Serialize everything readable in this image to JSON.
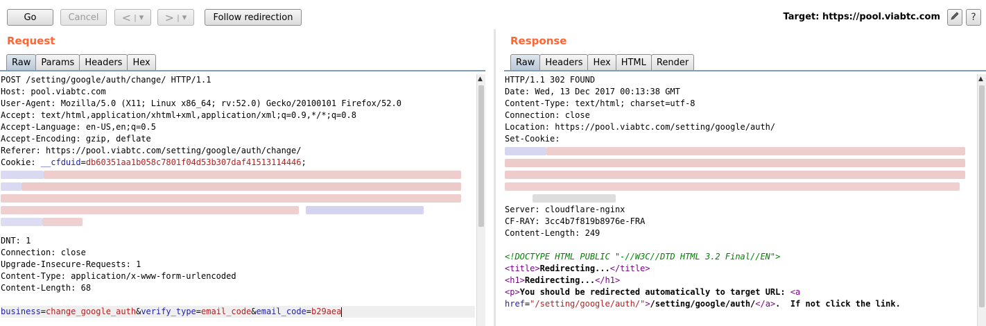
{
  "toolbar": {
    "go": "Go",
    "cancel": "Cancel",
    "back": "<",
    "back_menu": "▾",
    "forward": ">",
    "forward_menu": "▾",
    "follow": "Follow redirection",
    "target_label": "Target: https://pool.viabtc.com",
    "edit_icon": "pencil-icon",
    "help": "?"
  },
  "request": {
    "title": "Request",
    "tabs": [
      "Raw",
      "Params",
      "Headers",
      "Hex"
    ],
    "lines": [
      "POST /setting/google/auth/change/ HTTP/1.1",
      "Host: pool.viabtc.com",
      "User-Agent: Mozilla/5.0 (X11; Linux x86_64; rv:52.0) Gecko/20100101 Firefox/52.0",
      "Accept: text/html,application/xhtml+xml,application/xml;q=0.9,*/*;q=0.8",
      "Accept-Language: en-US,en;q=0.5",
      "Accept-Encoding: gzip, deflate",
      "Referer: https://pool.viabtc.com/setting/google/auth/change/"
    ],
    "cookie": {
      "label": "Cookie: ",
      "name": "__cfduid",
      "eq": "=",
      "value": "db60351aa1b058c7801f04d53b307daf41513114446",
      "end": ";"
    },
    "lines_after": [
      "DNT: 1",
      "Connection: close",
      "Upgrade-Insecure-Requests: 1",
      "Content-Type: application/x-www-form-urlencoded",
      "Content-Length: 68"
    ],
    "body": {
      "k1": "business",
      "v1": "change_google_auth",
      "k2": "verify_type",
      "v2": "email_code",
      "k3": "email_code",
      "v3": "b29aea",
      "eq": "=",
      "amp": "&"
    }
  },
  "response": {
    "title": "Response",
    "tabs": [
      "Raw",
      "Headers",
      "Hex",
      "HTML",
      "Render"
    ],
    "lines": [
      "HTTP/1.1 302 FOUND",
      "Date: Wed, 13 Dec 2017 00:13:38 GMT",
      "Content-Type: text/html; charset=utf-8",
      "Connection: close",
      "Location: https://pool.viabtc.com/setting/google/auth/",
      "Set-Cookie:"
    ],
    "lines_after": [
      "Server: cloudflare-nginx",
      "CF-RAY: 3cc4b7f819b8976e-FRA",
      "Content-Length: 249"
    ],
    "html": {
      "doctype": "<!DOCTYPE HTML PUBLIC \"-//W3C//DTD HTML 3.2 Final//EN\">",
      "title_open": "<title>",
      "title_text": "Redirecting...",
      "title_close": "</title>",
      "h1_open": "<h1>",
      "h1_text": "Redirecting...",
      "h1_close": "</h1>",
      "p_open": "<p>",
      "p_text": "You should be redirected automatically to target URL: ",
      "a_open": "<a",
      "href_attr": "href",
      "href_eq": "=",
      "href_val": "\"/setting/google/auth/\"",
      "a_gt": ">",
      "a_text": "/setting/google/auth/",
      "a_close": "</a>",
      "tail": ".  If not click the link."
    }
  }
}
